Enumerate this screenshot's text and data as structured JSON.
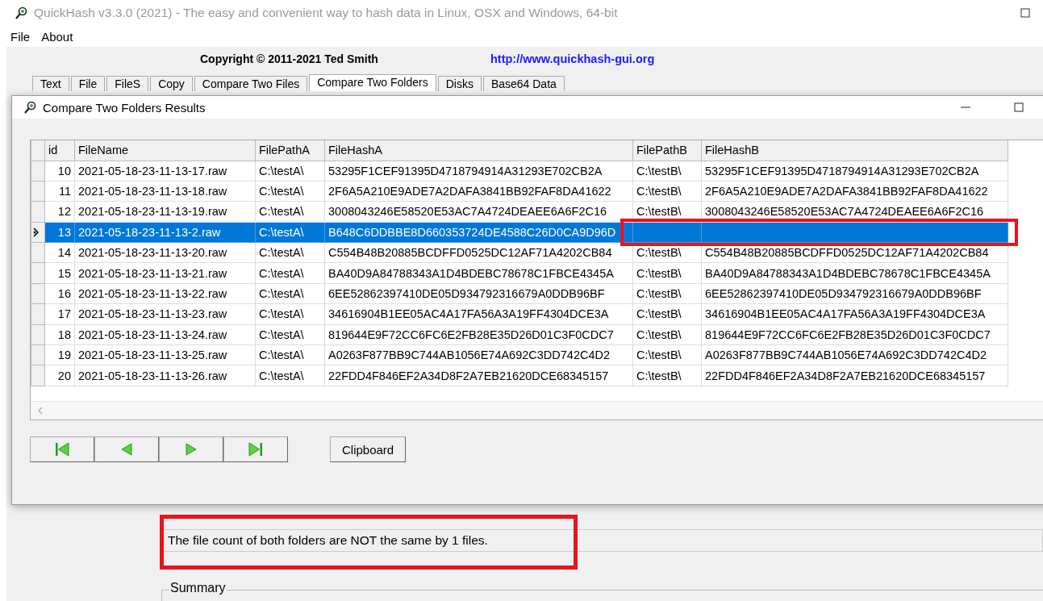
{
  "window": {
    "title": "QuickHash v3.3.0 (2021) - The easy and convenient way to hash data in Linux, OSX and Windows, 64-bit"
  },
  "menu": [
    "File",
    "About"
  ],
  "header": {
    "copyright": "Copyright © 2011-2021  Ted Smith",
    "link": "http://www.quickhash-gui.org"
  },
  "tabs": [
    {
      "label": "Text",
      "selected": false
    },
    {
      "label": "File",
      "selected": false
    },
    {
      "label": "FileS",
      "selected": false
    },
    {
      "label": "Copy",
      "selected": false
    },
    {
      "label": "Compare Two Files",
      "selected": false
    },
    {
      "label": "Compare Two Folders",
      "selected": true
    },
    {
      "label": "Disks",
      "selected": false
    },
    {
      "label": "Base64 Data",
      "selected": false
    }
  ],
  "dialog": {
    "title": "Compare Two Folders Results",
    "table": {
      "columns": [
        "id",
        "FileName",
        "FilePathA",
        "FileHashA",
        "FilePathB",
        "FileHashB"
      ],
      "rows": [
        {
          "selected": false,
          "cells": [
            "10",
            "2021-05-18-23-11-13-17.raw",
            "C:\\testA\\",
            "53295F1CEF91395D4718794914A31293E702CB2A",
            "C:\\testB\\",
            "53295F1CEF91395D4718794914A31293E702CB2A"
          ]
        },
        {
          "selected": false,
          "cells": [
            "11",
            "2021-05-18-23-11-13-18.raw",
            "C:\\testA\\",
            "2F6A5A210E9ADE7A2DAFA3841BB92FAF8DA41622",
            "C:\\testB\\",
            "2F6A5A210E9ADE7A2DAFA3841BB92FAF8DA41622"
          ]
        },
        {
          "selected": false,
          "cells": [
            "12",
            "2021-05-18-23-11-13-19.raw",
            "C:\\testA\\",
            "3008043246E58520E53AC7A4724DEAEE6A6F2C16",
            "C:\\testB\\",
            "3008043246E58520E53AC7A4724DEAEE6A6F2C16"
          ]
        },
        {
          "selected": true,
          "cells": [
            "13",
            "2021-05-18-23-11-13-2.raw",
            "C:\\testA\\",
            "B648C6DDBBE8D660353724DE4588C26D0CA9D96D",
            null,
            null
          ]
        },
        {
          "selected": false,
          "cells": [
            "14",
            "2021-05-18-23-11-13-20.raw",
            "C:\\testA\\",
            "C554B48B20885BCDFFD0525DC12AF71A4202CB84",
            "C:\\testB\\",
            "C554B48B20885BCDFFD0525DC12AF71A4202CB84"
          ]
        },
        {
          "selected": false,
          "cells": [
            "15",
            "2021-05-18-23-11-13-21.raw",
            "C:\\testA\\",
            "BA40D9A84788343A1D4BDEBC78678C1FBCE4345A",
            "C:\\testB\\",
            "BA40D9A84788343A1D4BDEBC78678C1FBCE4345A"
          ]
        },
        {
          "selected": false,
          "cells": [
            "16",
            "2021-05-18-23-11-13-22.raw",
            "C:\\testA\\",
            "6EE52862397410DE05D934792316679A0DDB96BF",
            "C:\\testB\\",
            "6EE52862397410DE05D934792316679A0DDB96BF"
          ]
        },
        {
          "selected": false,
          "cells": [
            "17",
            "2021-05-18-23-11-13-23.raw",
            "C:\\testA\\",
            "34616904B1EE05AC4A17FA56A3A19FF4304DCE3A",
            "C:\\testB\\",
            "34616904B1EE05AC4A17FA56A3A19FF4304DCE3A"
          ]
        },
        {
          "selected": false,
          "cells": [
            "18",
            "2021-05-18-23-11-13-24.raw",
            "C:\\testA\\",
            "819644E9F72CC6FC6E2FB28E35D26D01C3F0CDC7",
            "C:\\testB\\",
            "819644E9F72CC6FC6E2FB28E35D26D01C3F0CDC7"
          ]
        },
        {
          "selected": false,
          "cells": [
            "19",
            "2021-05-18-23-11-13-25.raw",
            "C:\\testA\\",
            "A0263F877BB9C744AB1056E74A692C3DD742C4D2",
            "C:\\testB\\",
            "A0263F877BB9C744AB1056E74A692C3DD742C4D2"
          ]
        },
        {
          "selected": false,
          "cells": [
            "20",
            "2021-05-18-23-11-13-26.raw",
            "C:\\testA\\",
            "22FDD4F846EF2A34D8F2A7EB21620DCE68345157",
            "C:\\testB\\",
            "22FDD4F846EF2A34D8F2A7EB21620DCE68345157"
          ]
        }
      ]
    },
    "nav_buttons": [
      {
        "kind": "first"
      },
      {
        "kind": "prev"
      },
      {
        "kind": "next"
      },
      {
        "kind": "last"
      }
    ],
    "clipboard_button": "Clipboard"
  },
  "status": {
    "value": "The file count of both folders are NOT the same by 1 files."
  },
  "summary": {
    "label": "Summary"
  }
}
